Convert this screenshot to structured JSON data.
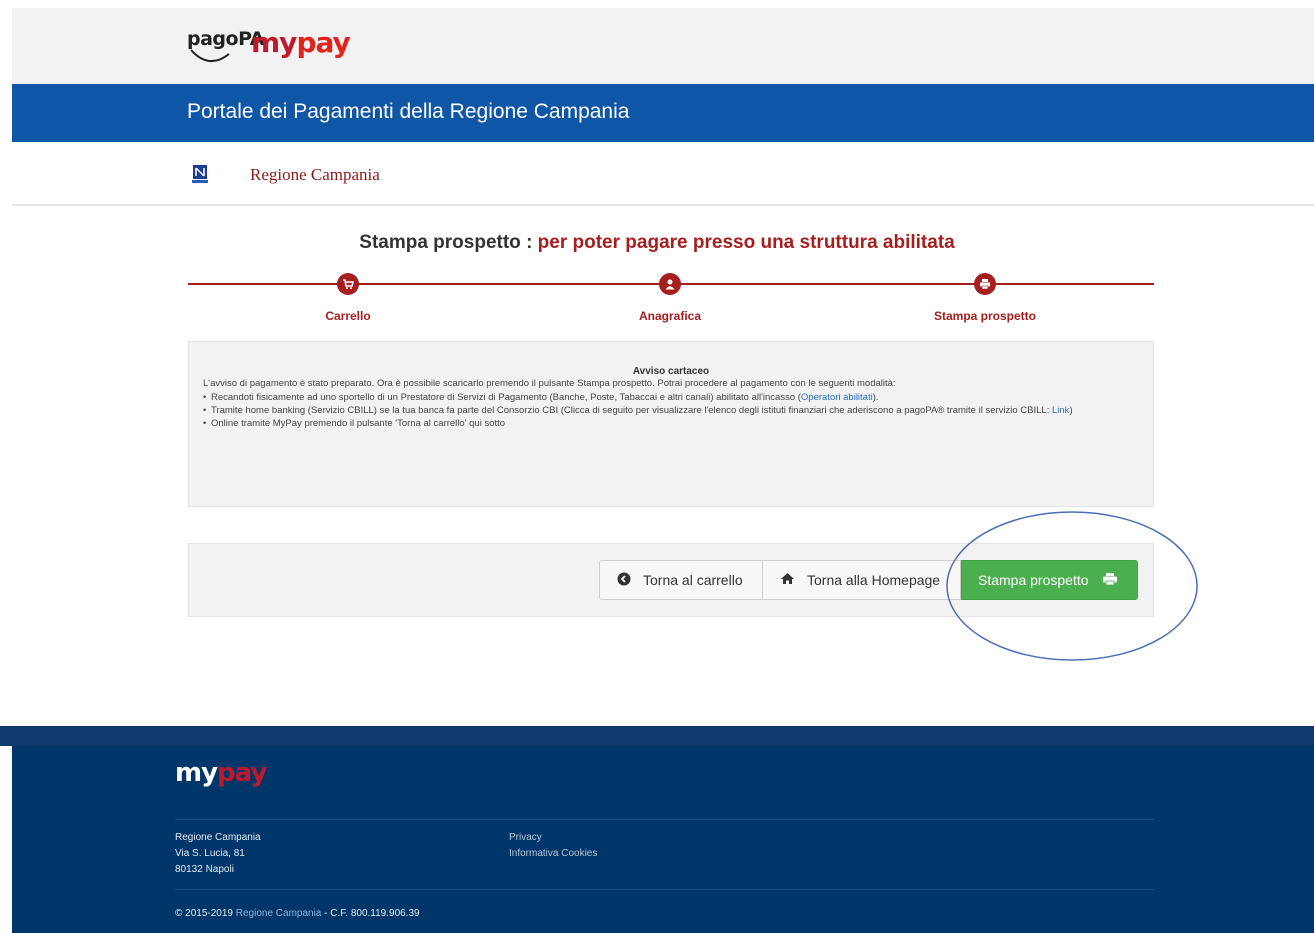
{
  "header": {
    "pagopa_logo_text": "pagoPA",
    "mypay_logo": {
      "my": "my",
      "pay": "pay"
    },
    "banner_title": "Portale dei Pagamenti della Regione Campania",
    "region_name": "Regione Campania"
  },
  "wizard": {
    "title_prefix": "Stampa prospetto : ",
    "title_highlight": "per poter pagare presso una struttura abilitata",
    "steps": [
      {
        "label": "Carrello",
        "icon": "cart-icon"
      },
      {
        "label": "Anagrafica",
        "icon": "user-icon"
      },
      {
        "label": "Stampa prospetto",
        "icon": "print-icon"
      }
    ]
  },
  "notice": {
    "heading": "Avviso cartaceo",
    "intro": "L'avviso di pagamento è stato preparato. Ora è possibile scaricarlo premendo il pulsante Stampa prospetto. Potrai procedere al pagamento con le seguenti modalità:",
    "item1_text": "Recandoti fisicamente ad uno sportello di un Prestatore di Servizi di Pagamento (Banche, Poste, Tabaccai e altri canali) abilitato all'incasso (",
    "item1_link": "Operatori abilitati",
    "item1_end": ").",
    "item2_text": "Tramite home banking (Servizio CBILL) se la tua banca fa parte del Consorzio CBI (Clicca di seguito per visualizzare l'elenco degli istituti finanziari che aderiscono a pagoPA® tramite il servizio CBILL: ",
    "item2_link": "Link",
    "item2_end": ")",
    "item3_text": "Online tramite MyPay premendo il pulsante 'Torna al carrello' qui sotto"
  },
  "actions": {
    "back_label": "Torna al carrello",
    "home_label": "Torna alla Homepage",
    "print_label": "Stampa prospetto"
  },
  "footer": {
    "logo": {
      "my": "my",
      "pay": "pay"
    },
    "address_line1": "Regione Campania",
    "address_line2": "Via S. Lucia, 81",
    "address_line3": "80132 Napoli",
    "link_privacy": "Privacy",
    "link_cookies": "Informativa Cookies",
    "copyright_prefix": "© 2015-2019 ",
    "copyright_link": "Regione Campania",
    "copyright_suffix": " - C.F. 800.119.906.39"
  },
  "colors": {
    "banner_blue": "#0f56a7",
    "accent_red": "#a61f1f",
    "print_green": "#4bae4f",
    "footer_navy": "#003669"
  }
}
